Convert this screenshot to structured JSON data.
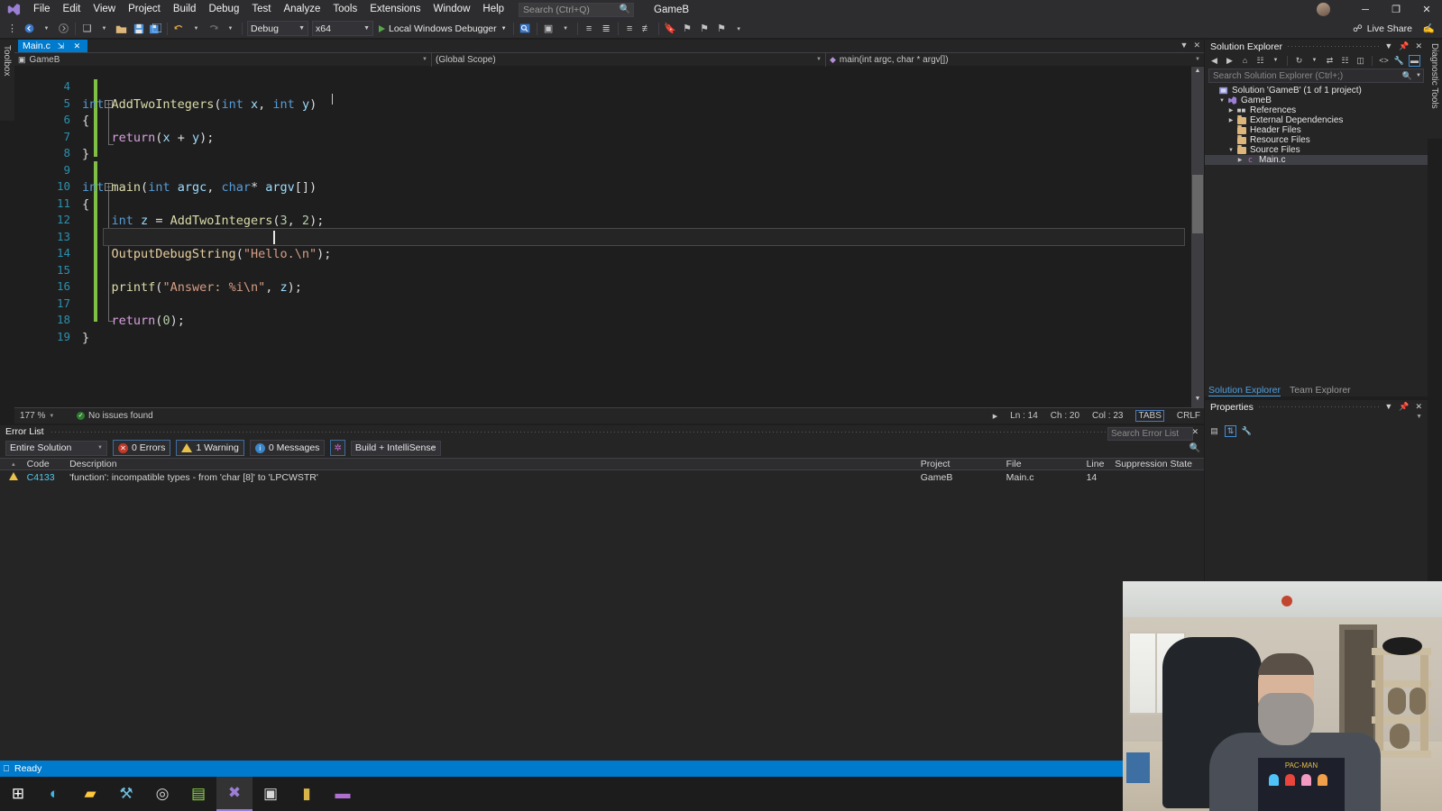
{
  "window": {
    "app_title": "GameB",
    "menu": [
      "File",
      "Edit",
      "View",
      "Project",
      "Build",
      "Debug",
      "Test",
      "Analyze",
      "Tools",
      "Extensions",
      "Window",
      "Help"
    ],
    "search_placeholder": "Search (Ctrl+Q)",
    "minimize": "─",
    "restore": "❐",
    "close": "✕",
    "live_share": "Live Share"
  },
  "toolbar": {
    "config": "Debug",
    "platform": "x64",
    "run_label": "Local Windows Debugger"
  },
  "document_tab": {
    "name": "Main.c",
    "pin": "⇲",
    "close": "✕"
  },
  "navbar": {
    "project": "GameB",
    "scope": "(Global Scope)",
    "member": "main(int argc, char * argv[])"
  },
  "editor": {
    "zoom": "177 %",
    "issues": "No issues found",
    "line_label": "Ln : 14",
    "char_label": "Ch : 20",
    "col_label": "Col : 23",
    "tabs_label": "TABS",
    "eol_label": "CRLF",
    "lines": [
      {
        "num": "4",
        "tokens": []
      },
      {
        "num": "5",
        "fold": "minus",
        "tokens": [
          {
            "t": "int",
            "c": "kw"
          },
          {
            "t": " ",
            "c": "pun"
          },
          {
            "t": "AddTwoIntegers",
            "c": "fn"
          },
          {
            "t": "(",
            "c": "pun"
          },
          {
            "t": "int",
            "c": "kw"
          },
          {
            "t": " ",
            "c": "pun"
          },
          {
            "t": "x",
            "c": "var"
          },
          {
            "t": ", ",
            "c": "pun"
          },
          {
            "t": "int",
            "c": "kw"
          },
          {
            "t": " ",
            "c": "pun"
          },
          {
            "t": "y",
            "c": "var"
          },
          {
            "t": ")",
            "c": "pun"
          }
        ]
      },
      {
        "num": "6",
        "tokens": [
          {
            "t": "{",
            "c": "pun"
          }
        ]
      },
      {
        "num": "7",
        "tokens": [
          {
            "t": "    ",
            "c": "pun"
          },
          {
            "t": "return",
            "c": "ctl"
          },
          {
            "t": "(",
            "c": "pun"
          },
          {
            "t": "x",
            "c": "var"
          },
          {
            "t": " + ",
            "c": "pun"
          },
          {
            "t": "y",
            "c": "var"
          },
          {
            "t": ");",
            "c": "pun"
          }
        ]
      },
      {
        "num": "8",
        "tokens": [
          {
            "t": "}",
            "c": "pun"
          }
        ]
      },
      {
        "num": "9",
        "tokens": []
      },
      {
        "num": "10",
        "fold": "minus",
        "tokens": [
          {
            "t": "int",
            "c": "kw"
          },
          {
            "t": " ",
            "c": "pun"
          },
          {
            "t": "main",
            "c": "fn"
          },
          {
            "t": "(",
            "c": "pun"
          },
          {
            "t": "int",
            "c": "kw"
          },
          {
            "t": " ",
            "c": "pun"
          },
          {
            "t": "argc",
            "c": "var"
          },
          {
            "t": ", ",
            "c": "pun"
          },
          {
            "t": "char",
            "c": "kw"
          },
          {
            "t": "* ",
            "c": "pun"
          },
          {
            "t": "argv",
            "c": "var"
          },
          {
            "t": "[])",
            "c": "pun"
          }
        ]
      },
      {
        "num": "11",
        "tokens": [
          {
            "t": "{",
            "c": "pun"
          }
        ]
      },
      {
        "num": "12",
        "tokens": [
          {
            "t": "    ",
            "c": "pun"
          },
          {
            "t": "int",
            "c": "kw"
          },
          {
            "t": " ",
            "c": "pun"
          },
          {
            "t": "z",
            "c": "var"
          },
          {
            "t": " = ",
            "c": "pun"
          },
          {
            "t": "AddTwoIntegers",
            "c": "fn"
          },
          {
            "t": "(",
            "c": "pun"
          },
          {
            "t": "3",
            "c": "num"
          },
          {
            "t": ", ",
            "c": "pun"
          },
          {
            "t": "2",
            "c": "num"
          },
          {
            "t": ");",
            "c": "pun"
          }
        ]
      },
      {
        "num": "13",
        "tokens": []
      },
      {
        "num": "14",
        "current": true,
        "tokens": [
          {
            "t": "    ",
            "c": "pun"
          },
          {
            "t": "OutputDebugString",
            "c": "fn2"
          },
          {
            "t": "(",
            "c": "pun"
          },
          {
            "t": "\"Hello.\\n\"",
            "c": "str"
          },
          {
            "t": ");",
            "c": "pun"
          }
        ]
      },
      {
        "num": "15",
        "tokens": []
      },
      {
        "num": "16",
        "tokens": [
          {
            "t": "    ",
            "c": "pun"
          },
          {
            "t": "printf",
            "c": "fn"
          },
          {
            "t": "(",
            "c": "pun"
          },
          {
            "t": "\"Answer: %i\\n\"",
            "c": "str"
          },
          {
            "t": ", ",
            "c": "pun"
          },
          {
            "t": "z",
            "c": "var"
          },
          {
            "t": ");",
            "c": "pun"
          }
        ]
      },
      {
        "num": "17",
        "tokens": []
      },
      {
        "num": "18",
        "tokens": [
          {
            "t": "    ",
            "c": "pun"
          },
          {
            "t": "return",
            "c": "ctl"
          },
          {
            "t": "(",
            "c": "pun"
          },
          {
            "t": "0",
            "c": "num"
          },
          {
            "t": ");",
            "c": "pun"
          }
        ]
      },
      {
        "num": "19",
        "tokens": [
          {
            "t": "}",
            "c": "pun"
          }
        ]
      }
    ]
  },
  "error_list": {
    "title": "Error List",
    "scope": "Entire Solution",
    "errors": "0 Errors",
    "warnings": "1 Warning",
    "messages": "0 Messages",
    "build_filter": "Build + IntelliSense",
    "search_placeholder": "Search Error List",
    "columns": [
      "",
      "Code",
      "Description",
      "Project",
      "File",
      "Line",
      "Suppression State"
    ],
    "rows": [
      {
        "icon": "warning",
        "code": "C4133",
        "description": "'function': incompatible types - from 'char [8]' to 'LPCWSTR'",
        "project": "GameB",
        "file": "Main.c",
        "line": "14",
        "suppression": ""
      }
    ]
  },
  "solution_explorer": {
    "title": "Solution Explorer",
    "search_placeholder": "Search Solution Explorer (Ctrl+;)",
    "tree": [
      {
        "label": "Solution 'GameB' (1 of 1 project)",
        "indent": 0,
        "twisty": "",
        "icon": "solution"
      },
      {
        "label": "GameB",
        "indent": 1,
        "twisty": "▼",
        "icon": "project"
      },
      {
        "label": "References",
        "indent": 2,
        "twisty": "▶",
        "icon": "refs"
      },
      {
        "label": "External Dependencies",
        "indent": 2,
        "twisty": "▶",
        "icon": "folder"
      },
      {
        "label": "Header Files",
        "indent": 2,
        "twisty": "",
        "icon": "folder"
      },
      {
        "label": "Resource Files",
        "indent": 2,
        "twisty": "",
        "icon": "folder"
      },
      {
        "label": "Source Files",
        "indent": 2,
        "twisty": "▼",
        "icon": "folder-open"
      },
      {
        "label": "Main.c",
        "indent": 3,
        "twisty": "▶",
        "icon": "cfile",
        "selected": true
      }
    ],
    "tabs": [
      {
        "label": "Solution Explorer",
        "active": true
      },
      {
        "label": "Team Explorer",
        "active": false
      }
    ]
  },
  "properties": {
    "title": "Properties"
  },
  "diagnostic_tools": {
    "label": "Diagnostic Tools"
  },
  "toolbox": {
    "label": "Toolbox"
  },
  "status_bar": {
    "text": "Ready"
  },
  "taskbar": {
    "items": [
      {
        "name": "start-button",
        "glyph": "⊞",
        "color": "#ffffff"
      },
      {
        "name": "edge-icon",
        "glyph": "◐",
        "color": "#3eb6e8"
      },
      {
        "name": "file-explorer-icon",
        "glyph": "▰",
        "color": "#ffc83d"
      },
      {
        "name": "tools-icon",
        "glyph": "⚒",
        "color": "#6fbfe0"
      },
      {
        "name": "obs-icon",
        "glyph": "◎",
        "color": "#cfcfcf"
      },
      {
        "name": "editor-icon",
        "glyph": "▤",
        "color": "#8fd44a"
      },
      {
        "name": "visual-studio-icon",
        "glyph": "✖",
        "color": "#9b7fd4",
        "active": true
      },
      {
        "name": "terminal-icon",
        "glyph": "▣",
        "color": "#d8d8d8"
      },
      {
        "name": "app-icon",
        "glyph": "▮",
        "color": "#d8b44a"
      },
      {
        "name": "media-icon",
        "glyph": "▬",
        "color": "#b06fd0"
      }
    ]
  },
  "colors": {
    "accent": "#007acc",
    "chrome": "#2d2d30",
    "panel": "#252526",
    "editor_bg": "#1e1e1e",
    "warning": "#e8c14a",
    "error": "#c0392b",
    "link": "#4ec9f0"
  }
}
